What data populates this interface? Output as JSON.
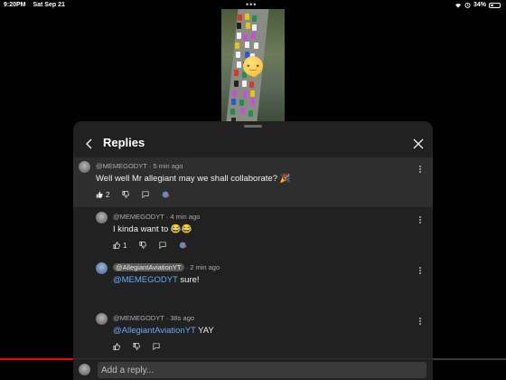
{
  "status_bar": {
    "time": "9:20PM",
    "date": "Sat Sep 21",
    "battery_text": "34%",
    "battery_level": 0.34
  },
  "video": {
    "overlay_emoji_icon": "pensive-face-icon"
  },
  "sheet": {
    "title": "Replies"
  },
  "parent_comment": {
    "author": "@MEMEGODYT",
    "age": "5 min ago",
    "text": "Well well Mr allegiant may we shall collaborate? 🎉",
    "likes": "2"
  },
  "replies": [
    {
      "author": "@MEMEGODYT",
      "age": "4 min ago",
      "text": "I kinda want to 😂😂",
      "likes": "1"
    },
    {
      "author": "@AllegiantAviationYT",
      "age": "2 min ago",
      "mention": "@MEMEGODYT",
      "text": " sure!"
    },
    {
      "author": "@MEMEGODYT",
      "age": "38s ago",
      "mention": "@AllegiantAviationYT",
      "text": " YAY"
    }
  ],
  "reply_bar": {
    "placeholder": "Add a reply..."
  },
  "colors": {
    "mention": "#6aa7ff",
    "progress": "#ff0000",
    "panel": "#212121",
    "highlight": "#2e2e2e"
  }
}
